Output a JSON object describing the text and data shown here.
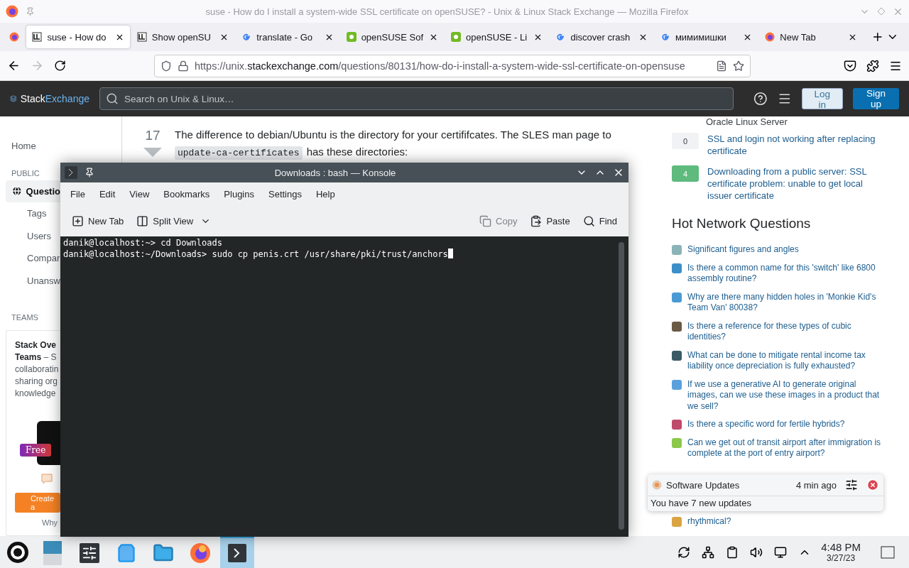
{
  "browser": {
    "window_title": "suse - How do I install a system-wide SSL certificate on openSUSE? - Unix & Linux Stack Exchange — Mozilla Firefox",
    "tabs": [
      {
        "label": "suse - How do",
        "selected": true,
        "kind": "site"
      },
      {
        "label": "Show openSU",
        "selected": false,
        "kind": "site"
      },
      {
        "label": "translate - Go",
        "selected": false,
        "kind": "google"
      },
      {
        "label": "openSUSE Sof",
        "selected": false,
        "kind": "suse"
      },
      {
        "label": "openSUSE - Li",
        "selected": false,
        "kind": "suse"
      },
      {
        "label": "discover crash",
        "selected": false,
        "kind": "google"
      },
      {
        "label": "мимимишки",
        "selected": false,
        "kind": "google"
      },
      {
        "label": "New Tab",
        "selected": false,
        "kind": "firefox"
      }
    ],
    "url": {
      "scheme": "https://unix.",
      "domain": "stackexchange.com",
      "path": "/questions/80131/how-do-i-install-a-system-wide-ssl-certificate-on-opensuse"
    }
  },
  "site": {
    "logo_left": "Stack",
    "logo_right": "Exchange",
    "search_placeholder": "Search on Unix & Linux…",
    "login": "Log in",
    "signup": "Sign up"
  },
  "sidebar": {
    "home": {
      "label": "Home",
      "selected": false
    },
    "public_heading": "PUBLIC",
    "public_items": [
      {
        "label": "Questio",
        "selected": true
      },
      {
        "label": "Tags",
        "selected": false
      },
      {
        "label": "Users",
        "selected": false
      },
      {
        "label": "Compar",
        "selected": false
      },
      {
        "label": "Unansw",
        "selected": false
      }
    ],
    "teams_heading": "TEAMS",
    "teams_lines": [
      "**Stack Ove**",
      "**Teams** – S",
      "collaboratin",
      "sharing org",
      "knowledge"
    ],
    "free_badge": "Free",
    "create_button": "Create a",
    "why_link": "Why"
  },
  "answer": {
    "votes": "17",
    "line1": "The difference to debian/Ubuntu is the directory for your certififcates. The SLES man page to",
    "code": "update-ca-certificates",
    "line2": "has these directories:"
  },
  "related": {
    "tail": "Oracle Linux Server",
    "items": [
      {
        "score": "0",
        "accepted": false,
        "title": "SSL and login not working after replacing certificate"
      },
      {
        "score": "4",
        "accepted": true,
        "title": "Downloading from a public server: SSL certificate problem: unable to get local issuer certificate"
      }
    ]
  },
  "hot": {
    "heading": "Hot Network Questions",
    "items": [
      {
        "title": "Significant figures and angles",
        "color": "#8ab4b8"
      },
      {
        "title": "Is there a common name for this 'switch' like 6800 assembly routine?",
        "color": "#3b8fc9"
      },
      {
        "title": "Why are there many hidden holes in 'Monkie Kid's Team Van' 80038?",
        "color": "#4a9bd4"
      },
      {
        "title": "Is there a reference for these types of cubic identities?",
        "color": "#6b5a45"
      },
      {
        "title": "What can be done to mitigate rental income tax liability once depreciation is fully exhausted?",
        "color": "#3a5a66"
      },
      {
        "title": "If we use a generative AI to generate original images, can we use these images in a product that we sell?",
        "color": "#5aa0dc"
      },
      {
        "title": "Is there a specific word for fertile hybrids?",
        "color": "#c04a6a"
      },
      {
        "title": "Can we get out of transit airport after immigration is complete at the port of entry airport?",
        "color": "#8cc84b"
      },
      {
        "title": "rhythmical?",
        "color": "#d9a441"
      }
    ]
  },
  "konsole": {
    "title": "Downloads : bash — Konsole",
    "menu": [
      "File",
      "Edit",
      "View",
      "Bookmarks",
      "Plugins",
      "Settings",
      "Help"
    ],
    "toolbar": [
      {
        "label": "New Tab",
        "kind": "newtab",
        "disabled": false
      },
      {
        "label": "Split View",
        "kind": "split",
        "disabled": false
      },
      {
        "label": "Copy",
        "kind": "copy",
        "disabled": true
      },
      {
        "label": "Paste",
        "kind": "paste",
        "disabled": false
      },
      {
        "label": "Find",
        "kind": "find",
        "disabled": false
      }
    ],
    "lines": [
      "danik@localhost:~> cd Downloads",
      "danik@localhost:~/Downloads> sudo cp penis.crt /usr/share/pki/trust/anchors"
    ]
  },
  "notification": {
    "app": "Software Updates",
    "time": "4 min ago",
    "body": "You have 7 new updates"
  },
  "taskbar": {
    "tasks": [
      {
        "kind": "desktop",
        "selected": false
      },
      {
        "kind": "settings",
        "selected": false
      },
      {
        "kind": "store",
        "selected": false
      },
      {
        "kind": "files",
        "selected": false
      },
      {
        "kind": "firefox",
        "selected": false
      },
      {
        "kind": "terminal",
        "selected": true
      }
    ],
    "time": "4:48 PM",
    "date": "3/27/23"
  }
}
